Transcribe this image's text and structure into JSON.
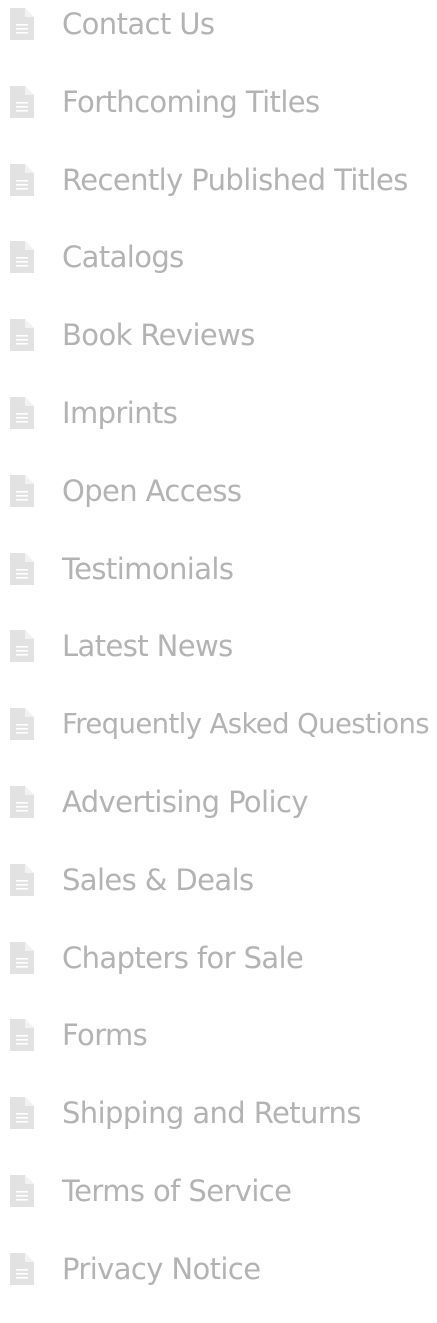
{
  "nav": {
    "icon": "document-icon",
    "icon_color": "#e2e2e2",
    "text_color": "#b3b3b3",
    "items": [
      {
        "label": "Contact Us"
      },
      {
        "label": "Forthcoming Titles"
      },
      {
        "label": "Recently Published Titles"
      },
      {
        "label": "Catalogs"
      },
      {
        "label": "Book Reviews"
      },
      {
        "label": "Imprints"
      },
      {
        "label": "Open Access"
      },
      {
        "label": "Testimonials"
      },
      {
        "label": "Latest News"
      },
      {
        "label": "Frequently Asked Questions"
      },
      {
        "label": "Advertising Policy"
      },
      {
        "label": "Sales & Deals"
      },
      {
        "label": "Chapters for Sale"
      },
      {
        "label": "Forms"
      },
      {
        "label": "Shipping and Returns"
      },
      {
        "label": "Terms of Service"
      },
      {
        "label": "Privacy Notice"
      }
    ]
  }
}
